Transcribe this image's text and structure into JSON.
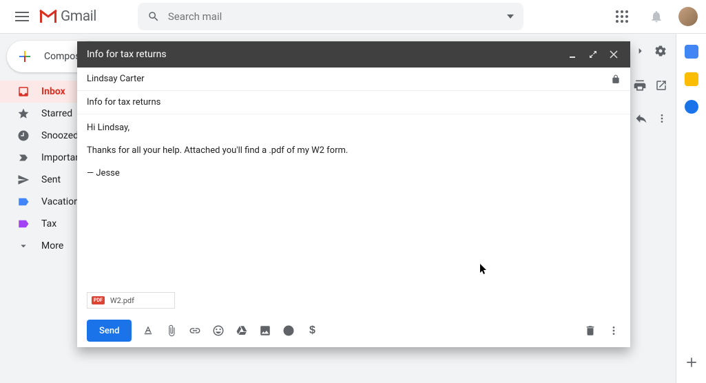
{
  "header": {
    "logo_text": "Gmail",
    "search_placeholder": "Search mail"
  },
  "sidebar": {
    "compose_label": "Compose",
    "items": [
      {
        "label": "Inbox"
      },
      {
        "label": "Starred"
      },
      {
        "label": "Snoozed"
      },
      {
        "label": "Important"
      },
      {
        "label": "Sent"
      },
      {
        "label": "Vacation"
      },
      {
        "label": "Tax"
      },
      {
        "label": "More"
      }
    ]
  },
  "compose": {
    "title": "Info for tax returns",
    "to": "Lindsay Carter",
    "subject": "Info for tax returns",
    "body_lines": [
      "Hi Lindsay,",
      "Thanks for all your help. Attached you'll find a .pdf of my W2 form.",
      "— Jesse"
    ],
    "attachment": {
      "badge": "PDF",
      "name": "W2.pdf"
    },
    "send_label": "Send"
  }
}
